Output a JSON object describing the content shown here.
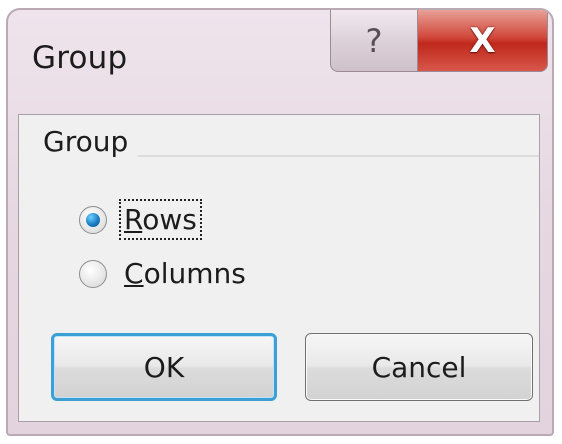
{
  "window": {
    "title": "Group",
    "help_glyph": "?",
    "close_glyph": "X"
  },
  "group_box": {
    "label": "Group"
  },
  "options": {
    "rows": {
      "mnemonic": "R",
      "rest": "ows",
      "checked": true
    },
    "columns": {
      "mnemonic": "C",
      "rest": "olumns",
      "checked": false
    }
  },
  "buttons": {
    "ok_label": "OK",
    "cancel_label": "Cancel"
  },
  "colors": {
    "title_bar": "#e5d6e0",
    "close_button": "#c0281c",
    "default_button_border": "#3aa0d6",
    "radio_selected": "#1b7fc4"
  },
  "icons": {
    "help": "question-mark-icon",
    "close": "close-icon"
  }
}
